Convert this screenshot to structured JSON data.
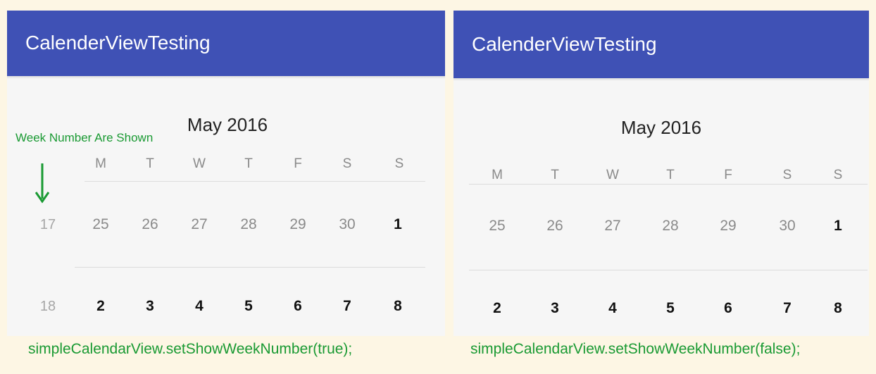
{
  "colors": {
    "page_background": "#fdf6e4",
    "app_bar": "#3f51b5",
    "annotation_green": "#1a9a33"
  },
  "left": {
    "app_title": "CalenderViewTesting",
    "month_title": "May 2016",
    "annotation": "Week Number Are Shown",
    "annotation_icon": "down-arrow-icon",
    "week_headers": [
      "M",
      "T",
      "W",
      "T",
      "F",
      "S",
      "S"
    ],
    "weeks": [
      {
        "number": "17",
        "days": [
          "25",
          "26",
          "27",
          "28",
          "29",
          "30",
          "1"
        ]
      },
      {
        "number": "18",
        "days": [
          "2",
          "3",
          "4",
          "5",
          "6",
          "7",
          "8"
        ]
      }
    ],
    "caption": "simpleCalendarView.setShowWeekNumber(true);"
  },
  "right": {
    "app_title": "CalenderViewTesting",
    "month_title": "May 2016",
    "week_headers": [
      "M",
      "T",
      "W",
      "T",
      "F",
      "S",
      "S"
    ],
    "weeks": [
      {
        "days": [
          "25",
          "26",
          "27",
          "28",
          "29",
          "30",
          "1"
        ]
      },
      {
        "days": [
          "2",
          "3",
          "4",
          "5",
          "6",
          "7",
          "8"
        ]
      }
    ],
    "caption": "simpleCalendarView.setShowWeekNumber(false);"
  }
}
